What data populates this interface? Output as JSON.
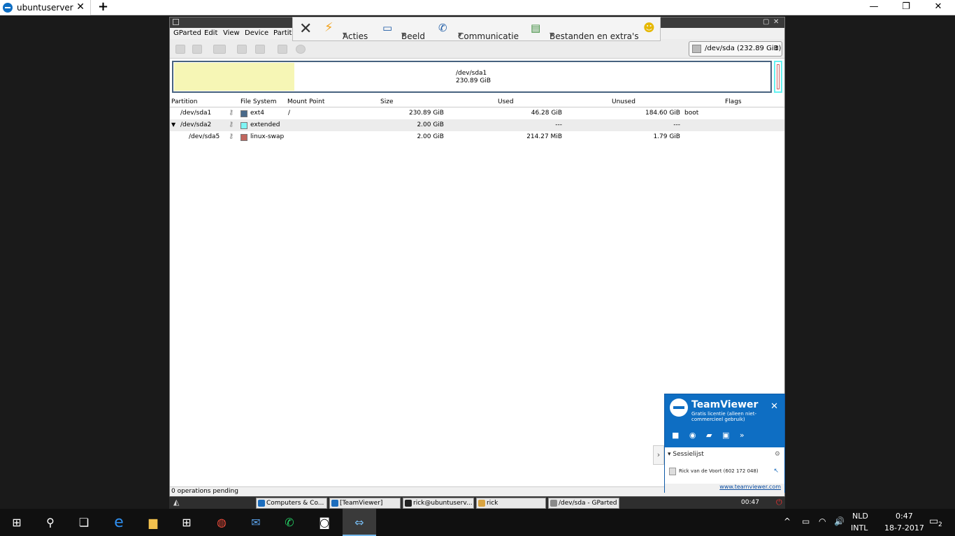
{
  "tab": {
    "title": "ubuntuserver",
    "new_tab": "+",
    "close": "✕"
  },
  "window_controls": {
    "minimize": "—",
    "maximize": "❐",
    "close": "✕"
  },
  "gparted": {
    "menu": [
      "GParted",
      "Edit",
      "View",
      "Device",
      "Partiti"
    ],
    "device_selector": "/dev/sda  (232.89 GiB)",
    "graph": {
      "name": "/dev/sda1",
      "size": "230.89 GiB"
    },
    "columns": [
      "Partition",
      "File System",
      "Mount Point",
      "Size",
      "Used",
      "Unused",
      "Flags"
    ],
    "rows": [
      {
        "partition": "/dev/sda1",
        "fs": "ext4",
        "fs_color": "#4a6a8a",
        "mount": "/",
        "size": "230.89 GiB",
        "used": "46.28 GiB",
        "unused": "184.60 GiB",
        "flags": "boot"
      },
      {
        "partition": "/dev/sda2",
        "fs": "extended",
        "fs_color": "#7ff5f5",
        "mount": "",
        "size": "2.00 GiB",
        "used": "---",
        "unused": "---",
        "flags": ""
      },
      {
        "partition": "/dev/sda5",
        "fs": "linux-swap",
        "fs_color": "#c1665e",
        "mount": "",
        "size": "2.00 GiB",
        "used": "214.27 MiB",
        "unused": "1.79 GiB",
        "flags": ""
      }
    ],
    "status": "0 operations pending"
  },
  "remote_taskbar": {
    "items": [
      "Computers & Co...",
      "[TeamViewer]",
      "rick@ubuntuserv...",
      "rick",
      "/dev/sda - GParted"
    ],
    "time": "00:47"
  },
  "tv_toolbar": {
    "actions": "Acties",
    "view": "Beeld",
    "communication": "Communicatie",
    "files": "Bestanden en extra's"
  },
  "tv_panel": {
    "brand": "TeamViewer",
    "license": "Gratis licentie (alleen niet-commercieel gebruik)",
    "session_list": "Sessielijst",
    "session_user": "Rick van de Voort (602 172 048)",
    "link": "www.teamviewer.com"
  },
  "tray": {
    "lang1": "NLD",
    "lang2": "INTL",
    "time": "0:47",
    "date": "18-7-2017",
    "notifications": "2"
  }
}
